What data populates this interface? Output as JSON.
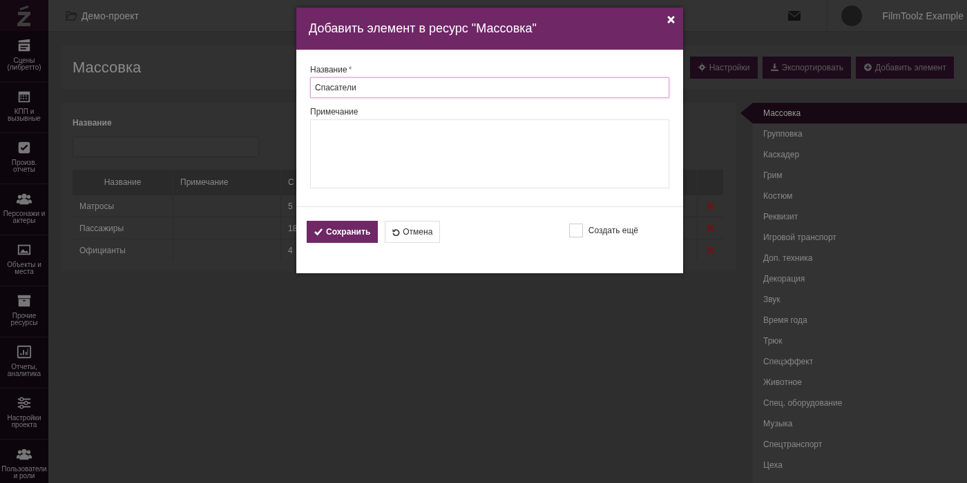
{
  "sidebar": {
    "items": [
      {
        "label": "Сцены (либретто)"
      },
      {
        "label": "КПП и вызывные"
      },
      {
        "label": "Произв. отчеты"
      },
      {
        "label": "Персонажи и актеры"
      },
      {
        "label": "Объекты и места"
      },
      {
        "label": "Прочие ресурсы"
      },
      {
        "label": "Отчеты, аналитика"
      },
      {
        "label": "Настройки проекта"
      },
      {
        "label": "Пользователи и роли"
      }
    ]
  },
  "topbar": {
    "project": "Демо-проект",
    "user": "FilmToolz Example"
  },
  "header": {
    "title": "Массовка",
    "buttons": [
      {
        "label": "Настройки"
      },
      {
        "label": "Экспортировать"
      },
      {
        "label": "Добавить элемент"
      }
    ]
  },
  "filter": {
    "label": "Название"
  },
  "table": {
    "columns": [
      "Название",
      "Примечание",
      "С"
    ],
    "rows": [
      {
        "cells": [
          "Матросы",
          null,
          "5"
        ]
      },
      {
        "cells": [
          "Пассажиры",
          null,
          "18"
        ]
      },
      {
        "cells": [
          "Официанты",
          null,
          "4"
        ]
      }
    ]
  },
  "resource_nav": {
    "items": [
      {
        "label": "Массовка",
        "selected": true
      },
      {
        "label": "Групповка",
        "selected": false
      },
      {
        "label": "Каскадер",
        "selected": false
      },
      {
        "label": "Грим",
        "selected": false
      },
      {
        "label": "Костюм",
        "selected": false
      },
      {
        "label": "Реквизит",
        "selected": false
      },
      {
        "label": "Игровой транспорт",
        "selected": false
      },
      {
        "label": "Доп. техника",
        "selected": false
      },
      {
        "label": "Декорация",
        "selected": false
      },
      {
        "label": "Звук",
        "selected": false
      },
      {
        "label": "Время года",
        "selected": false
      },
      {
        "label": "Трюк",
        "selected": false
      },
      {
        "label": "Спецэффект",
        "selected": false
      },
      {
        "label": "Животное",
        "selected": false
      },
      {
        "label": "Спец. оборудование",
        "selected": false
      },
      {
        "label": "Музыка",
        "selected": false
      },
      {
        "label": "Спецтранспорт",
        "selected": false
      },
      {
        "label": "Цеха",
        "selected": false
      }
    ]
  },
  "modal": {
    "title": "Добавить элемент в ресурс \"Массовка\"",
    "fields": [
      {
        "kind": "input",
        "label": "Название",
        "required_mark": "*",
        "value": "Спасатели"
      },
      {
        "kind": "textarea",
        "label": "Примечание"
      }
    ],
    "save_button": "Сохранить",
    "cancel_button": "Отмена",
    "create_more": {
      "label": "Создать ещё",
      "checked": false
    }
  }
}
